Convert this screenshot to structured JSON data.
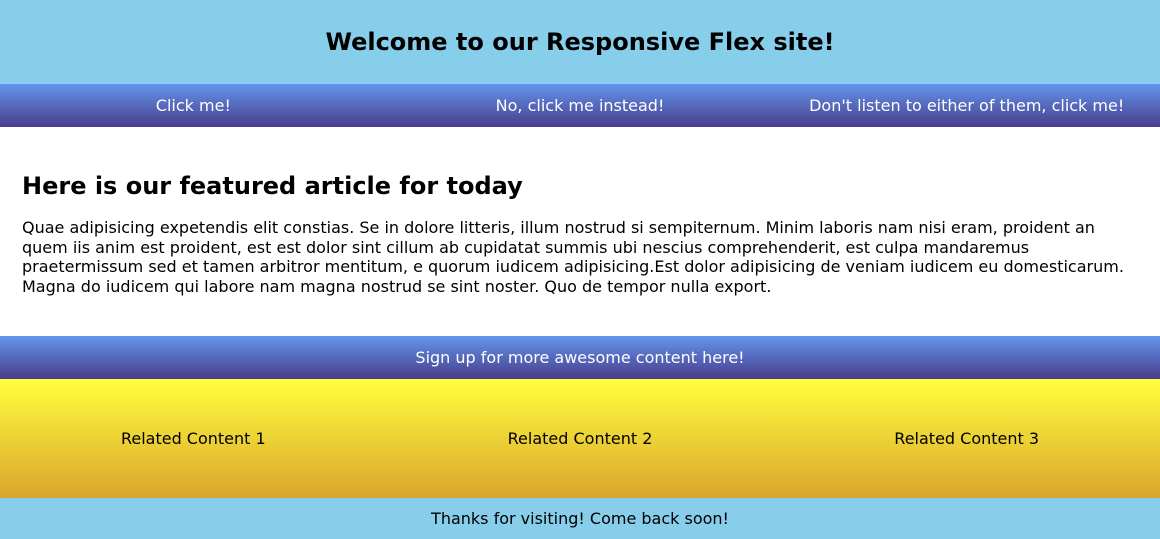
{
  "header": {
    "title": "Welcome to our Responsive Flex site!"
  },
  "nav": {
    "links": [
      {
        "label": "Click me!"
      },
      {
        "label": "No, click me instead!"
      },
      {
        "label": "Don't listen to either of them, click me!"
      }
    ]
  },
  "article": {
    "heading": "Here is our featured article for today",
    "body": "Quae adipisicing expetendis elit constias. Se in dolore litteris, illum nostrud si sempiternum. Minim laboris nam nisi eram, proident an quem iis anim est proident, est est dolor sint cillum ab cupidatat summis ubi nescius comprehenderit, est culpa mandaremus praetermissum sed et tamen arbitror mentitum, e quorum iudicem adipisicing.Est dolor adipisicing de veniam iudicem eu domesticarum. Magna do iudicem qui labore nam magna nostrud se sint noster. Quo de tempor nulla export."
  },
  "signup": {
    "label": "Sign up for more awesome content here!"
  },
  "related": {
    "items": [
      {
        "label": "Related Content 1"
      },
      {
        "label": "Related Content 2"
      },
      {
        "label": "Related Content 3"
      }
    ]
  },
  "footer": {
    "text": "Thanks for visiting! Come back soon!"
  },
  "colors": {
    "header_bg": "#87ceeb",
    "nav_gradient_top": "#6495ed",
    "nav_gradient_bottom": "#483d8b",
    "related_gradient_top": "#ffff3d",
    "related_gradient_bottom": "#daa52d",
    "footer_bg": "#87ceeb"
  }
}
